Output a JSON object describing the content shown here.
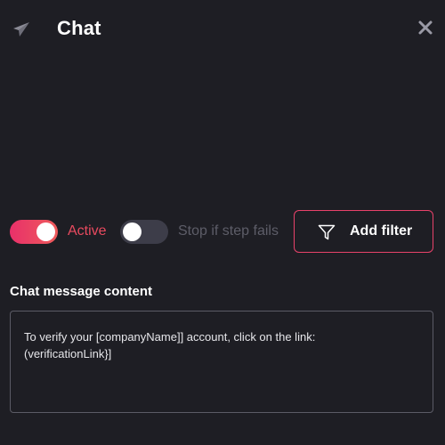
{
  "header": {
    "title": "Chat",
    "left_icon": "send-icon",
    "close_icon": "close-icon"
  },
  "controls": {
    "active_toggle": {
      "label": "Active",
      "on": true
    },
    "stop_toggle": {
      "label": "Stop if step fails",
      "on": false
    },
    "filter_button": {
      "label": "Add filter",
      "icon": "filter-icon"
    }
  },
  "message": {
    "label": "Chat message content",
    "content": "To verify your [companyName]] account, click on the link:\n(verificationLink}]"
  },
  "colors": {
    "background": "#1e1e24",
    "accent": "#e8306a",
    "accent_end": "#ef5b5b",
    "active_label": "#e94a5f",
    "muted_label": "#5d5d68",
    "toggle_off": "#3d3d49"
  }
}
